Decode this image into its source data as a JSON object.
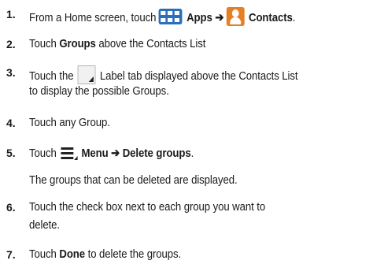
{
  "steps": [
    {
      "num": "1.",
      "lines": [
        {
          "a": "From a Home screen, touch",
          "apps": "Apps",
          "arrow": "➔",
          "contacts": "Contacts",
          "end": "."
        }
      ]
    },
    {
      "num": "2.",
      "lines": [
        {
          "pre": "Touch",
          "bold": "Groups",
          "post": "above the Contacts List"
        }
      ]
    },
    {
      "num": "3.",
      "lines": [
        {
          "pre": "Touch the",
          "post": "Label tab displayed above the Contacts List"
        },
        {
          "text": "to display the possible Groups."
        }
      ]
    },
    {
      "num": "4.",
      "lines": [
        {
          "text": "Touch any Group."
        }
      ]
    },
    {
      "num": "5.",
      "lines": [
        {
          "pre": "Touch",
          "bold": "Menu ➔ Delete groups",
          "end": "."
        }
      ]
    },
    {
      "num": "",
      "lines": [
        {
          "text": "The groups that can be deleted are displayed."
        }
      ]
    },
    {
      "num": "6.",
      "lines": [
        {
          "text": "Touch the check box next to each group you want to"
        },
        {
          "text": "delete."
        }
      ]
    },
    {
      "num": "7.",
      "lines": [
        {
          "pre": "Touch",
          "bold": "Done",
          "post": "to delete the groups."
        }
      ]
    }
  ]
}
